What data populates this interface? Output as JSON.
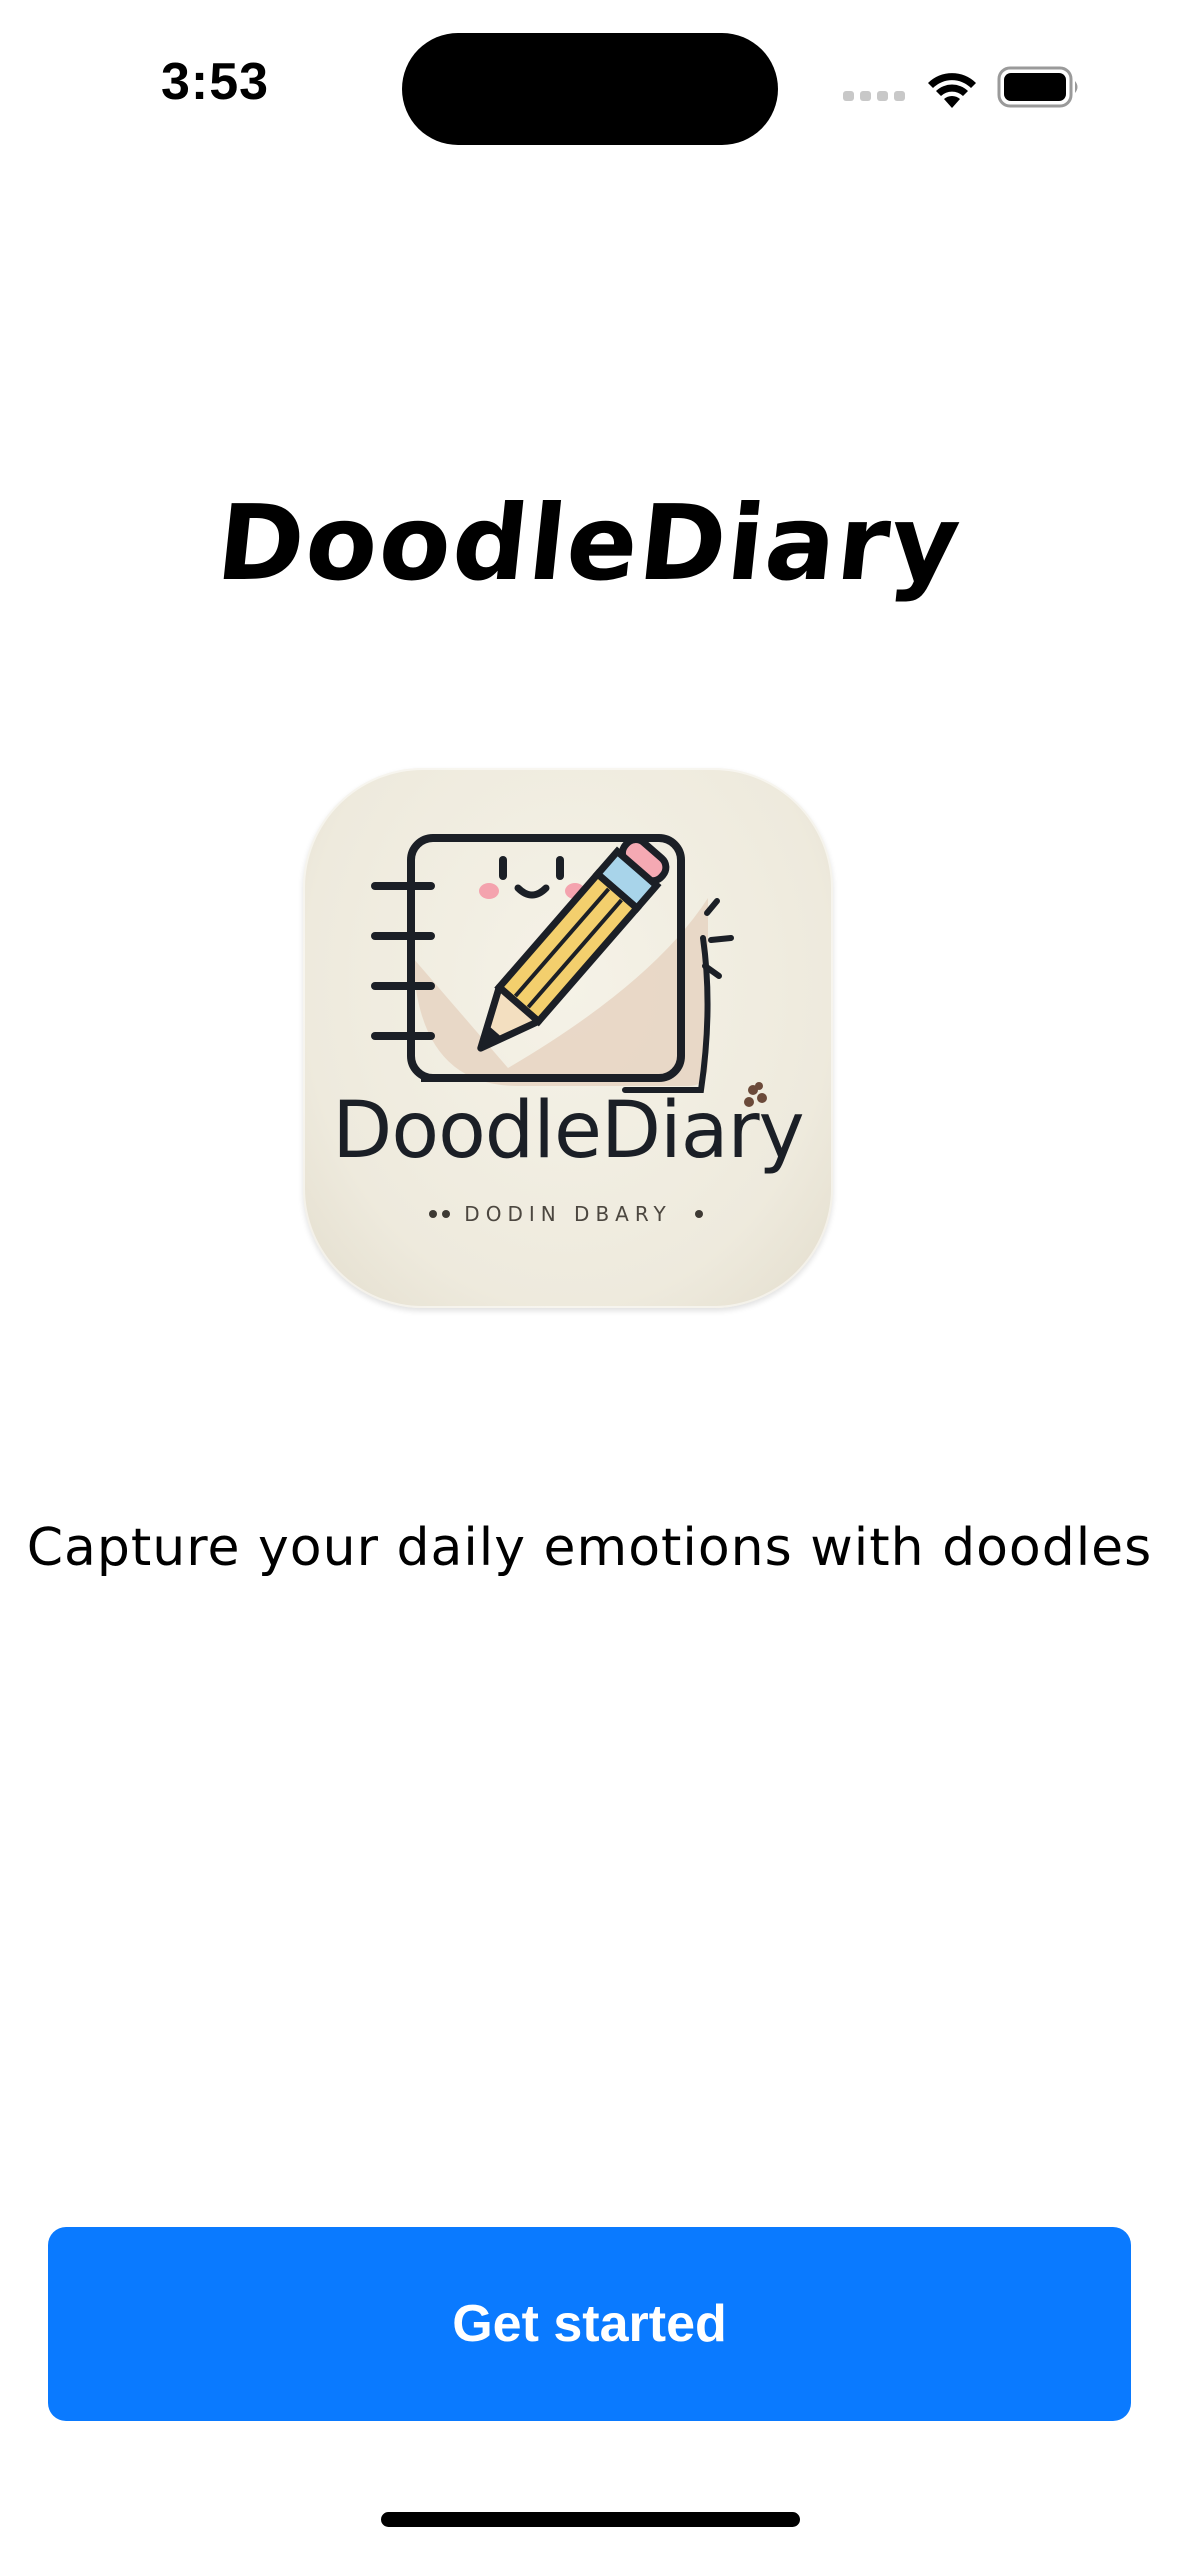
{
  "status_bar": {
    "time": "3:53",
    "icons": [
      "signal-icon",
      "wifi-icon",
      "battery-icon"
    ]
  },
  "main": {
    "title": "DoodleDiary",
    "logo": {
      "wordmark": "DoodleDiary",
      "subtext": "DODIN DBARY",
      "icons": [
        "notebook-icon",
        "pencil-icon",
        "smiley-face-icon"
      ]
    },
    "tagline": "Capture your daily emotions with doodles"
  },
  "actions": {
    "get_started_label": "Get started"
  },
  "colors": {
    "accent": "#0a7aff",
    "background": "#ffffff",
    "text": "#000000",
    "logo_tile": "#eeeadd"
  }
}
